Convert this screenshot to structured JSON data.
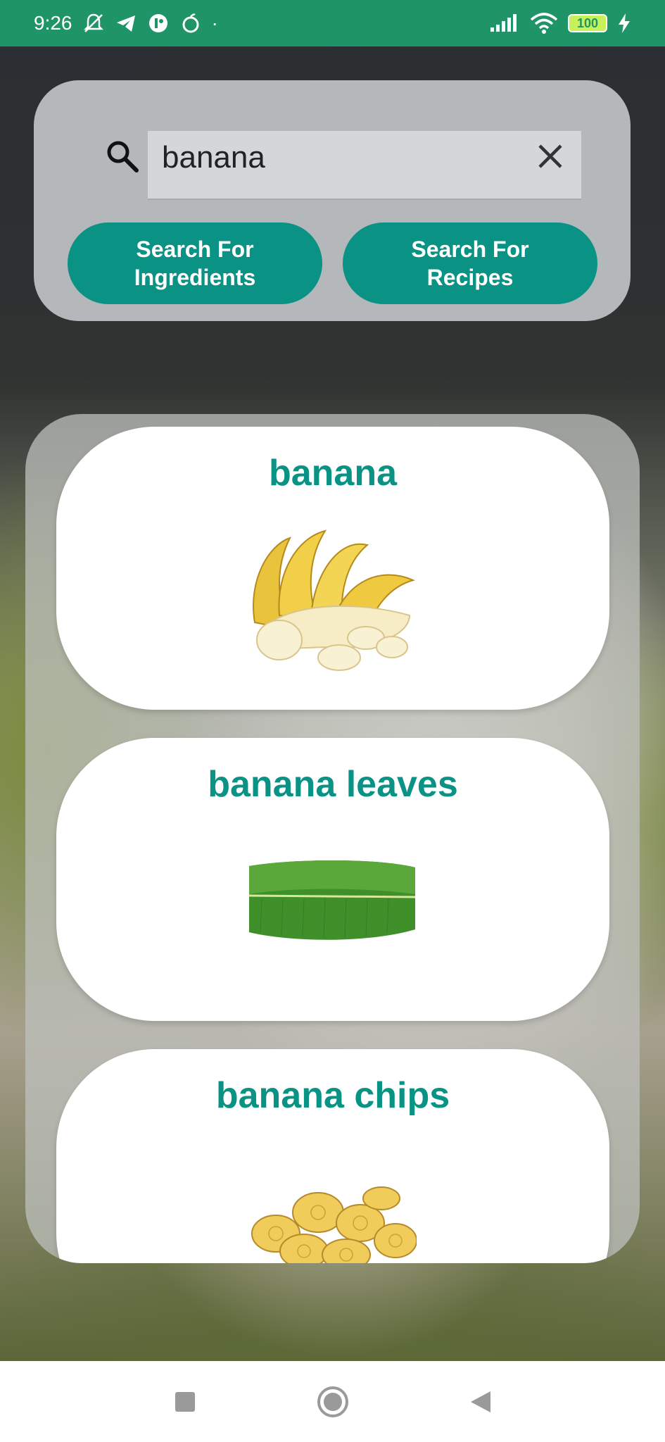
{
  "status_bar": {
    "time": "9:26",
    "dot": "·",
    "battery": "100",
    "icons": [
      "mute-bell-icon",
      "telegram-icon",
      "app-icon",
      "apple-icon",
      "signal-icon",
      "wifi-icon",
      "battery-icon",
      "charging-icon"
    ]
  },
  "search": {
    "query": "banana",
    "search_icon": "search-icon",
    "clear_icon": "close-icon",
    "ingredients_button": "Search For\nIngredients",
    "recipes_button": "Search For\nRecipes"
  },
  "results": [
    {
      "title": "banana",
      "image": "banana-image"
    },
    {
      "title": "banana leaves",
      "image": "banana-leaf-image"
    },
    {
      "title": "banana chips",
      "image": "banana-chips-image"
    }
  ],
  "nav": {
    "recents": "square-icon",
    "home": "circle-icon",
    "back": "back-triangle-icon"
  },
  "colors": {
    "status_bar": "#1f9467",
    "accent": "#0a9384",
    "panel": "#c8cbce"
  }
}
